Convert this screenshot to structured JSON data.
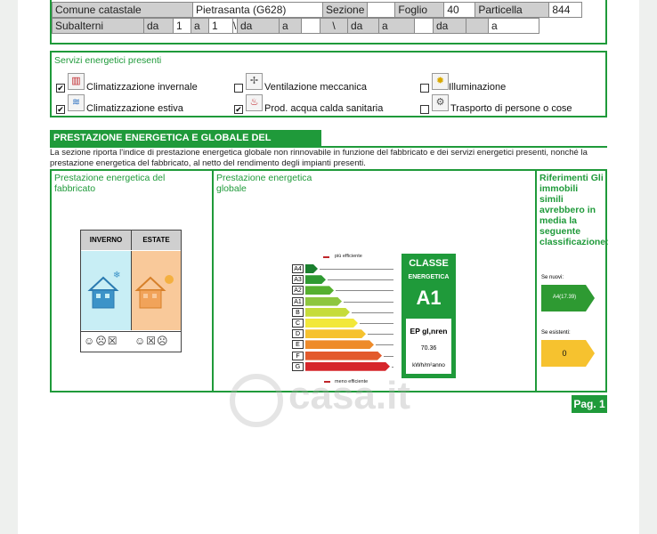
{
  "cadastre": {
    "comune_label": "Comune catastale",
    "comune_value": "Pietrasanta (G628)",
    "sezione_label": "Sezione",
    "foglio_label": "Foglio",
    "foglio_value": "40",
    "particella_label": "Particella",
    "particella_value": "844",
    "subalterni_label": "Subalterni",
    "da1": "da",
    "v1": "1",
    "a1": "a",
    "v2": "1",
    "bs1": "\\",
    "da2": "da",
    "a2": "a",
    "bs2": "\\",
    "da3": "da",
    "a3": "a",
    "bs3": "\\",
    "da4": "da",
    "a4": "a"
  },
  "services": {
    "title": "Servizi energetici presenti",
    "items": [
      {
        "label": "Climatizzazione invernale",
        "checked": true,
        "icon": "radiator-icon"
      },
      {
        "label": "Ventilazione meccanica",
        "checked": false,
        "icon": "fan-icon"
      },
      {
        "label": "Illuminazione",
        "checked": false,
        "icon": "lamp-icon"
      },
      {
        "label": "Climatizzazione estiva",
        "checked": true,
        "icon": "air-conditioner-icon"
      },
      {
        "label": "Prod. acqua calda sanitaria",
        "checked": true,
        "icon": "faucet-icon"
      },
      {
        "label": "Trasporto di persone o cose",
        "checked": false,
        "icon": "gears-icon"
      }
    ]
  },
  "performance": {
    "banner": "PRESTAZIONE ENERGETICA E GLOBALE DEL FABBRICATO.",
    "intro": "La sezione riporta l'indice di prestazione energetica globale non rinnovabile in funzione del fabbricato e dei servizi energetici presenti, nonché la prestazione energetica del fabbricato, al netto del rendimento degli impianti presenti.",
    "col1_title": "Prestazione energetica del fabbricato",
    "col2_title": "Prestazione energetica globale",
    "col3_title": "Riferimenti Gli immobili simili avrebbero in media la seguente classificazione:",
    "inverno": "INVERNO",
    "estate": "ESTATE",
    "piu_efficiente": "più efficiente",
    "meno_efficiente": "meno efficiente",
    "classes": [
      "A4",
      "A3",
      "A2",
      "A1",
      "B",
      "C",
      "D",
      "E",
      "F",
      "G"
    ],
    "class_colors": [
      "#1a7f2e",
      "#2e9a32",
      "#56b030",
      "#8dc63f",
      "#c6dc3a",
      "#f2e83a",
      "#f6c22f",
      "#ee8b2a",
      "#e35a2c",
      "#d6262b"
    ],
    "classe_energetica_l1": "CLASSE",
    "classe_energetica_l2": "ENERGETICA",
    "classe_value": "A1",
    "ep_label": "EP gl,nren",
    "ep_value": "70.36",
    "ep_unit": "kWh/m²anno",
    "se_nuovi": "Se nuovi:",
    "se_nuovi_value": "A4(17.39)",
    "se_esistenti": "Se esistenti:",
    "se_esistenti_value": "0",
    "page": "Pag. 1"
  },
  "watermark": "casa.it"
}
